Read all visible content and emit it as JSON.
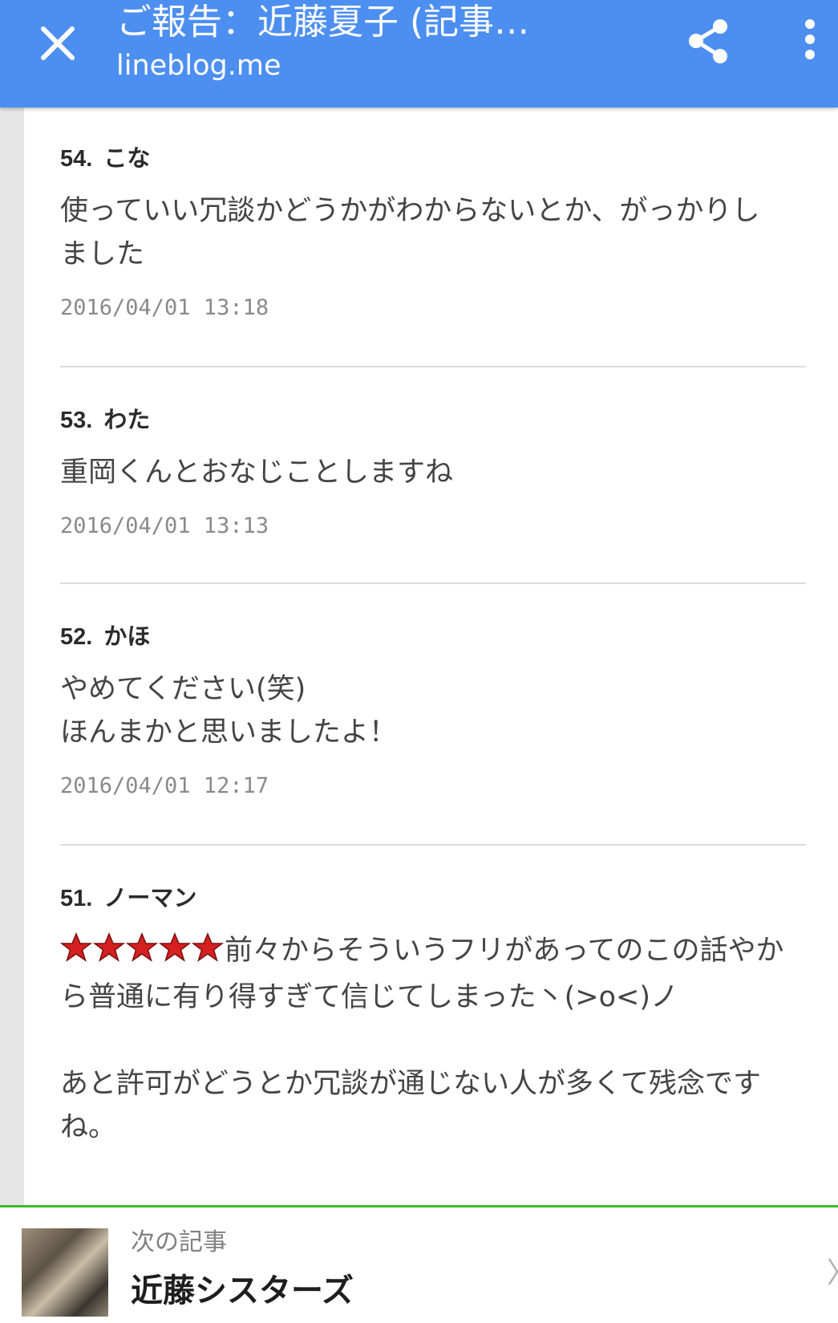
{
  "header": {
    "title": "ご報告：近藤夏子 (記事…",
    "domain": "lineblog.me",
    "close_icon": "close-icon",
    "share_icon": "share-icon",
    "more_icon": "more-vert-icon"
  },
  "comments": [
    {
      "number": "54.",
      "author": "こな",
      "lines": [
        "使っていい冗談かどうかがわからないとか、がっかりし",
        "ました"
      ],
      "time": "2016/04/01 13:18"
    },
    {
      "number": "53.",
      "author": "わた",
      "lines": [
        "重岡くんとおなじことしますね"
      ],
      "time": "2016/04/01 13:13"
    },
    {
      "number": "52.",
      "author": "かほ",
      "lines": [
        "やめてください(笑)",
        "ほんまかと思いましたよ！"
      ],
      "time": "2016/04/01 12:17"
    },
    {
      "number": "51.",
      "author": "ノーマン",
      "stars": 5,
      "lines": [
        "前々からそういうフリがあってのこの話やか",
        "ら普通に有り得すぎて信じてしまった丶(>o<)ノ",
        "",
        "あと許可がどうとか冗談が通じない人が多くて残念です",
        "ね。"
      ]
    }
  ],
  "next_article": {
    "label": "次の記事",
    "title": "近藤シスターズ",
    "chevron_icon": "chevron-right-icon"
  },
  "colors": {
    "app_bar": "#4d8ff0",
    "accent_border": "#3dbb2e",
    "star": "#d42020"
  }
}
